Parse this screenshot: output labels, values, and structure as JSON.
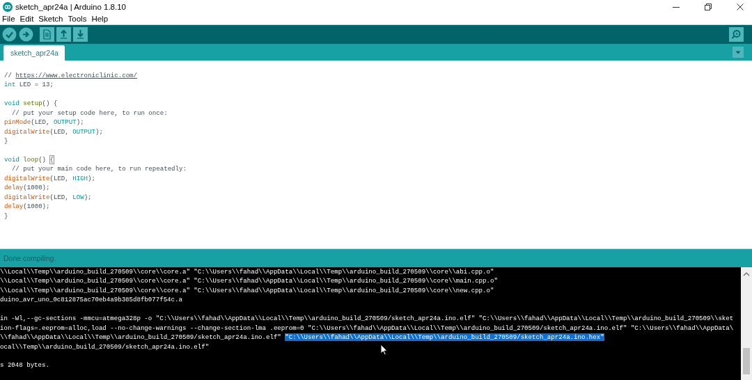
{
  "window": {
    "title": "sketch_apr24a | Arduino 1.8.10"
  },
  "menu": [
    {
      "label": "File"
    },
    {
      "label": "Edit"
    },
    {
      "label": "Sketch"
    },
    {
      "label": "Tools"
    },
    {
      "label": "Help"
    }
  ],
  "toolbar": {
    "left": [
      {
        "kind": "verify"
      },
      {
        "kind": "upload"
      },
      {
        "kind": "new"
      },
      {
        "kind": "open"
      },
      {
        "kind": "save"
      }
    ],
    "right": [
      {
        "kind": "serial_monitor"
      }
    ]
  },
  "tabs": [
    {
      "label": "sketch_apr24a",
      "selected": true
    }
  ],
  "editor": {
    "lines": [
      {
        "kind": "code",
        "tokens": [
          {
            "kind": "comment",
            "text": "// "
          },
          {
            "kind": "link",
            "text": "https://www.electroniclinic.com/"
          }
        ]
      },
      {
        "kind": "code",
        "tokens": [
          {
            "kind": "keyword",
            "text": "int"
          },
          {
            "kind": "plain",
            "text": " LED = 13;"
          }
        ]
      },
      {
        "kind": "blank"
      },
      {
        "kind": "code",
        "tokens": [
          {
            "kind": "keyword",
            "text": "void "
          },
          {
            "kind": "structure",
            "text": "setup"
          },
          {
            "kind": "plain",
            "text": "() {"
          }
        ]
      },
      {
        "kind": "code",
        "tokens": [
          {
            "kind": "comment",
            "text": "  // put your setup code here, to run once:"
          }
        ]
      },
      {
        "kind": "code",
        "tokens": [
          {
            "kind": "function",
            "text": "pinMode"
          },
          {
            "kind": "plain",
            "text": "(LED, "
          },
          {
            "kind": "constant",
            "text": "OUTPUT"
          },
          {
            "kind": "plain",
            "text": ");"
          }
        ]
      },
      {
        "kind": "code",
        "tokens": [
          {
            "kind": "function",
            "text": "digitalWrite"
          },
          {
            "kind": "plain",
            "text": "(LED, "
          },
          {
            "kind": "constant",
            "text": "OUTPUT"
          },
          {
            "kind": "plain",
            "text": ");"
          }
        ]
      },
      {
        "kind": "code",
        "tokens": [
          {
            "kind": "plain",
            "text": "}"
          }
        ]
      },
      {
        "kind": "blank"
      },
      {
        "kind": "code",
        "tokens": [
          {
            "kind": "keyword",
            "text": "void "
          },
          {
            "kind": "structure",
            "text": "loop"
          },
          {
            "kind": "plain",
            "text": "() "
          },
          {
            "kind": "bracket_match",
            "text": "{"
          }
        ]
      },
      {
        "kind": "code",
        "tokens": [
          {
            "kind": "comment",
            "text": "  // put your main code here, to run repeatedly:"
          }
        ]
      },
      {
        "kind": "code",
        "tokens": [
          {
            "kind": "function",
            "text": "digitalWrite"
          },
          {
            "kind": "plain",
            "text": "(LED, "
          },
          {
            "kind": "constant",
            "text": "HIGH"
          },
          {
            "kind": "plain",
            "text": ");"
          }
        ]
      },
      {
        "kind": "code",
        "tokens": [
          {
            "kind": "function",
            "text": "delay"
          },
          {
            "kind": "plain",
            "text": "(1000);"
          }
        ]
      },
      {
        "kind": "code",
        "tokens": [
          {
            "kind": "function",
            "text": "digitalWrite"
          },
          {
            "kind": "plain",
            "text": "(LED, "
          },
          {
            "kind": "constant",
            "text": "LOW"
          },
          {
            "kind": "plain",
            "text": ");"
          }
        ]
      },
      {
        "kind": "code",
        "tokens": [
          {
            "kind": "function",
            "text": "delay"
          },
          {
            "kind": "plain",
            "text": "(1000);"
          }
        ]
      },
      {
        "kind": "code",
        "tokens": [
          {
            "kind": "plain",
            "text": "}"
          }
        ]
      }
    ]
  },
  "status": {
    "message": "Done compiling."
  },
  "console": {
    "lines": [
      {
        "kind": "text",
        "text": "\\\\Local\\\\Temp\\\\arduino_build_270509\\\\core\\\\core.a\" \"C:\\\\Users\\\\fahad\\\\AppData\\\\Local\\\\Temp\\\\arduino_build_270509\\\\core\\\\abi.cpp.o\""
      },
      {
        "kind": "text",
        "text": "\\\\Local\\\\Temp\\\\arduino_build_270509\\\\core\\\\core.a\" \"C:\\\\Users\\\\fahad\\\\AppData\\\\Local\\\\Temp\\\\arduino_build_270509\\\\core\\\\main.cpp.o\""
      },
      {
        "kind": "text",
        "text": "\\\\Local\\\\Temp\\\\arduino_build_270509\\\\core\\\\core.a\" \"C:\\\\Users\\\\fahad\\\\AppData\\\\Local\\\\Temp\\\\arduino_build_270509\\\\core\\\\new.cpp.o\""
      },
      {
        "kind": "text",
        "text": "duino_avr_uno_0c812875ac70eb4a9b385d8fb077f54c.a"
      },
      {
        "kind": "blank"
      },
      {
        "kind": "text",
        "text": "in -Wl,--gc-sections -mmcu=atmega328p -o \"C:\\\\Users\\\\fahad\\\\AppData\\\\Local\\\\Temp\\\\arduino_build_270509/sketch_apr24a.ino.elf\" \"C:\\\\Users\\\\fahad\\\\AppData\\\\Local\\\\Temp\\\\arduino_build_270509\\\\sket"
      },
      {
        "kind": "text",
        "text": "ion-flags=.eeprom=alloc,load --no-change-warnings --change-section-lma .eeprom=0 \"C:\\\\Users\\\\fahad\\\\AppData\\\\Local\\\\Temp\\\\arduino_build_270509/sketch_apr24a.ino.elf\" \"C:\\\\Users\\\\fahad\\\\AppData\\"
      },
      {
        "kind": "text",
        "text": "\\\\fahad\\\\AppData\\\\Local\\\\Temp\\\\arduino_build_270509/sketch_apr24a.ino.elf\" ",
        "highlighted_text": "\"C:\\\\Users\\\\fahad\\\\AppData\\\\Local\\\\Temp\\\\arduino_build_270509/sketch_apr24a.ino.hex\""
      },
      {
        "kind": "text",
        "text": "ocal\\\\Temp\\\\arduino_build_270509/sketch_apr24a.ino.elf\""
      },
      {
        "kind": "blank"
      },
      {
        "kind": "text",
        "text": "s 2048 bytes."
      }
    ]
  }
}
